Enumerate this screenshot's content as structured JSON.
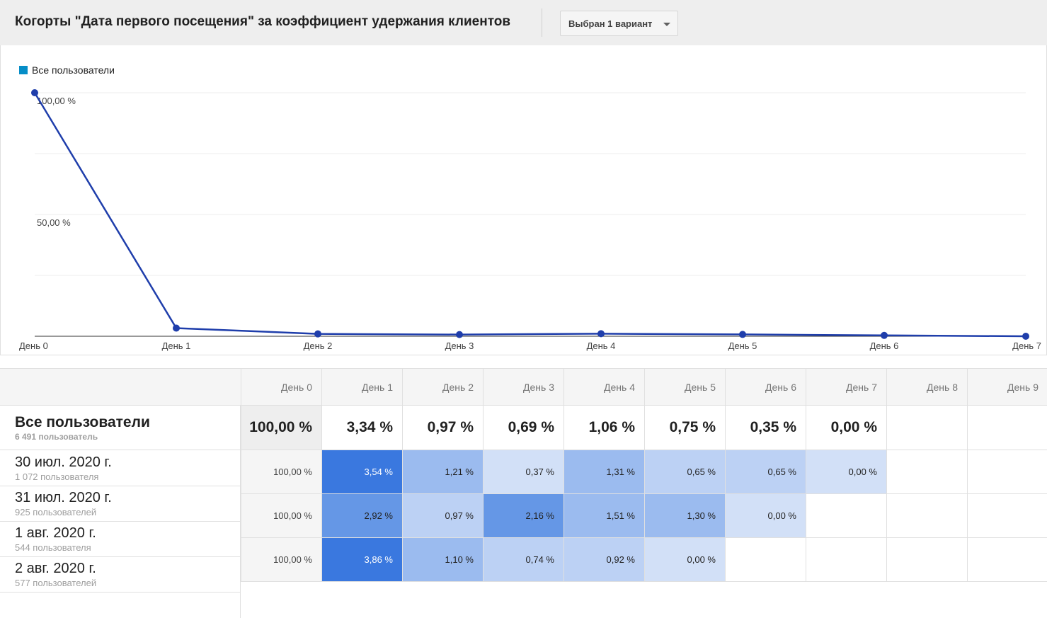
{
  "header": {
    "title": "Когорты \"Дата первого посещения\" за коэффициент удержания клиентов",
    "select_label": "Выбран 1 вариант"
  },
  "legend": {
    "label": "Все пользователи",
    "color": "#058dc7"
  },
  "chart_data": {
    "type": "line",
    "categories": [
      "День 0",
      "День 1",
      "День 2",
      "День 3",
      "День 4",
      "День 5",
      "День 6",
      "День 7"
    ],
    "series": [
      {
        "name": "Все пользователи",
        "color": "#1f3eab",
        "values": [
          100.0,
          3.34,
          0.97,
          0.69,
          1.06,
          0.75,
          0.35,
          0.0
        ]
      }
    ],
    "ylim": [
      0,
      100
    ],
    "y_ticks": [
      {
        "value": 100,
        "label": "100,00 %"
      },
      {
        "value": 50,
        "label": "50,00 %"
      }
    ],
    "grid": true,
    "legend_position": "top-left"
  },
  "table": {
    "columns": [
      "День 0",
      "День 1",
      "День 2",
      "День 3",
      "День 4",
      "День 5",
      "День 6",
      "День 7",
      "День 8",
      "День 9"
    ],
    "total": {
      "name": "Все пользователи",
      "count": "6 491 пользователь",
      "values": [
        "100,00 %",
        "3,34 %",
        "0,97 %",
        "0,69 %",
        "1,06 %",
        "0,75 %",
        "0,35 %",
        "0,00 %",
        "",
        ""
      ]
    },
    "rows": [
      {
        "date": "30 июл. 2020 г.",
        "users": "1 072 пользователя",
        "values": [
          "100,00 %",
          "3,54 %",
          "1,21 %",
          "0,37 %",
          "1,31 %",
          "0,65 %",
          "0,65 %",
          "0,00 %",
          "",
          ""
        ],
        "levels": [
          0,
          5,
          3,
          1,
          3,
          2,
          2,
          1,
          -1,
          -1
        ]
      },
      {
        "date": "31 июл. 2020 г.",
        "users": "925 пользователей",
        "values": [
          "100,00 %",
          "2,92 %",
          "0,97 %",
          "2,16 %",
          "1,51 %",
          "1,30 %",
          "0,00 %",
          "",
          "",
          ""
        ],
        "levels": [
          0,
          4,
          2,
          4,
          3,
          3,
          1,
          -1,
          -1,
          -1
        ]
      },
      {
        "date": "1 авг. 2020 г.",
        "users": "544 пользователя",
        "values": [
          "100,00 %",
          "3,86 %",
          "1,10 %",
          "0,74 %",
          "0,92 %",
          "0,00 %",
          "",
          "",
          "",
          ""
        ],
        "levels": [
          0,
          5,
          3,
          2,
          2,
          1,
          -1,
          -1,
          -1,
          -1
        ]
      },
      {
        "date": "2 авг. 2020 г.",
        "users": "577 пользователей"
      }
    ]
  }
}
